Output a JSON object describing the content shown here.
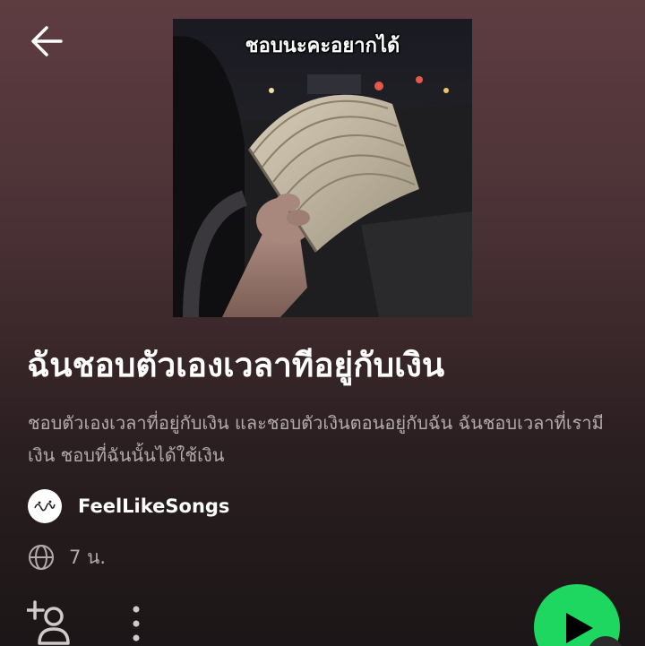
{
  "header": {
    "back_icon": "arrow-left-icon"
  },
  "cover": {
    "caption": "ชอบนะคะอยากได้"
  },
  "playlist": {
    "title": "ฉันชอบตัวเองเวลาทีอยู่กับเงิน",
    "description": "ชอบตัวเองเวลาที่อยู่กับเงิน และชอบตัวเงินตอนอยู่กับฉัน ฉันชอบเวลาที่เรามีเงิน ชอบที่ฉันนั้นได้ใช้เงิน",
    "owner": "FeelLikeSongs",
    "visibility_icon": "globe-icon",
    "duration": "7 น."
  },
  "actions": {
    "follow_icon": "add-person-icon",
    "more_icon": "more-vertical-icon",
    "play_icon": "play-icon"
  },
  "colors": {
    "accent": "#1ed760",
    "text_secondary": "#b3abab",
    "background_top": "#5e3d41"
  }
}
